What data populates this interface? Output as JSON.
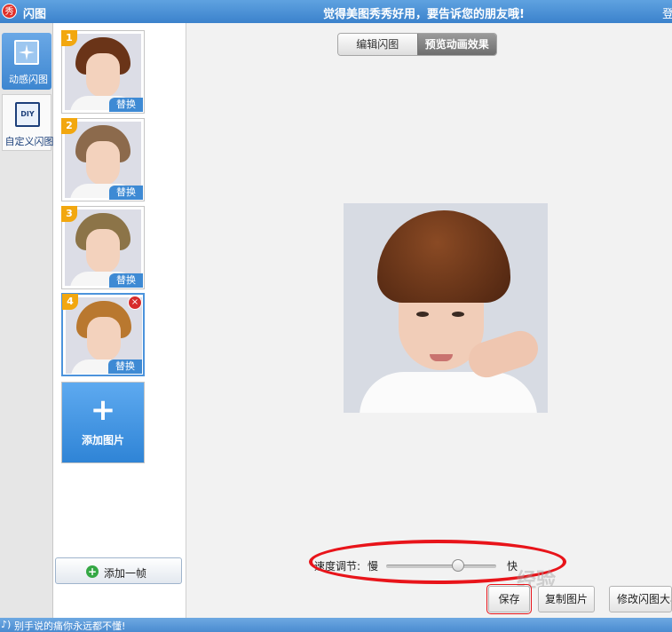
{
  "titlebar": {
    "app_logo": "秀",
    "title": "闪图",
    "slogan": "觉得美图秀秀好用，要告诉您的朋友哦!",
    "login": "登"
  },
  "modes": [
    {
      "label": "动感闪图",
      "icon": "sparkle-icon",
      "active": true
    },
    {
      "label": "自定义闪图",
      "icon_text": "DIY",
      "active": false
    }
  ],
  "frames": {
    "items": [
      {
        "number": "1",
        "replace_label": "替换",
        "hair_color": "#6a3418"
      },
      {
        "number": "2",
        "replace_label": "替换",
        "hair_color": "#8c6a4c"
      },
      {
        "number": "3",
        "replace_label": "替换",
        "hair_color": "#8c7448"
      },
      {
        "number": "4",
        "replace_label": "替换",
        "hair_color": "#b9782f",
        "selected": true,
        "delete_icon": "×"
      }
    ],
    "add_image": {
      "plus": "+",
      "label": "添加图片"
    },
    "add_frame": {
      "icon": "+",
      "label": "添加一帧"
    }
  },
  "main": {
    "tabs": [
      {
        "label": "编辑闪图",
        "active": false
      },
      {
        "label": "预览动画效果",
        "active": true
      }
    ],
    "speed": {
      "label": "速度调节:",
      "slow": "慢",
      "fast": "快",
      "value": 0.65
    },
    "buttons": {
      "save": "保存",
      "copy": "复制图片",
      "resize": "修改闪图大小"
    },
    "watermark": "经验"
  },
  "statusbar": {
    "icon": "♪)",
    "text": "别手说的痛你永远都不懂!"
  },
  "colors": {
    "accent": "#3e8ad4",
    "highlight": "#e8141a",
    "badge": "#f2a70f"
  }
}
